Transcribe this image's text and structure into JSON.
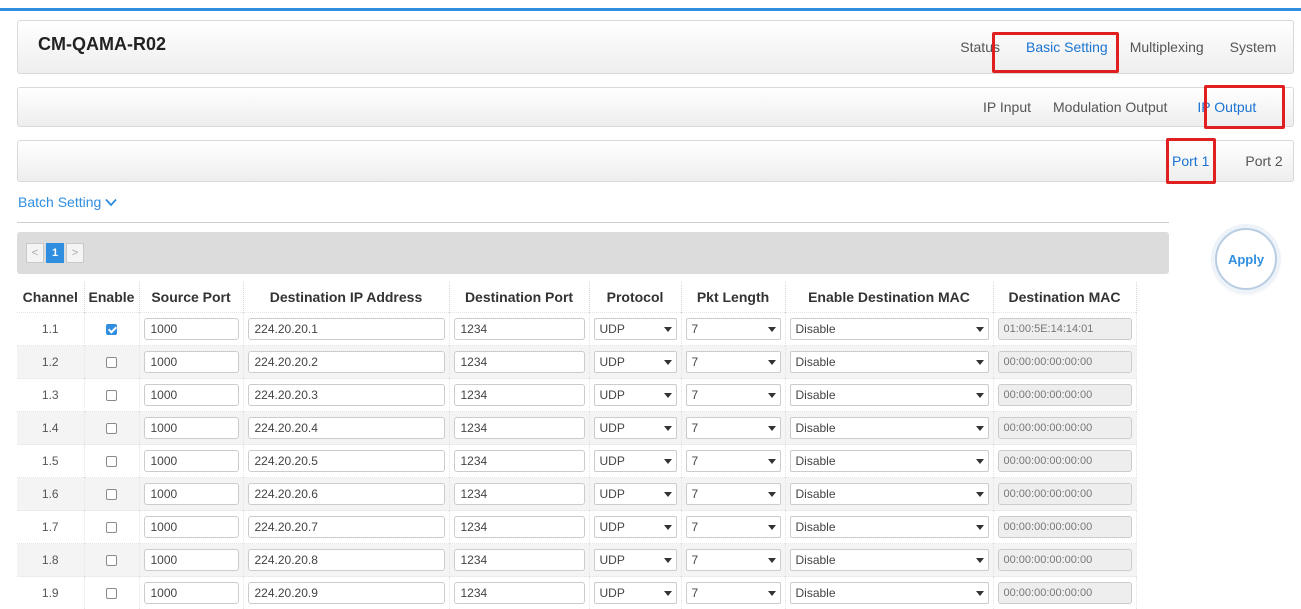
{
  "app": {
    "title": "CM-QAMA-R02"
  },
  "main_nav": [
    "Status",
    "Basic Setting",
    "Multiplexing",
    "System"
  ],
  "sub_nav": [
    "IP Input",
    "Modulation Output",
    "IP Output"
  ],
  "port_tabs": [
    "Port 1",
    "Port 2"
  ],
  "batch_setting": {
    "label": "Batch Setting"
  },
  "pager": {
    "prev": "<",
    "current": "1",
    "next": ">"
  },
  "apply_label": "Apply",
  "table": {
    "headers": [
      "Channel",
      "Enable",
      "Source Port",
      "Destination IP Address",
      "Destination Port",
      "Protocol",
      "Pkt Length",
      "Enable Destination MAC",
      "Destination MAC"
    ],
    "rows": [
      {
        "channel": "1.1",
        "enabled": true,
        "source_port": "1000",
        "dest_ip": "224.20.20.1",
        "dest_port": "1234",
        "protocol": "UDP",
        "pkt_length": "7",
        "enable_dest_mac": "Disable",
        "dest_mac": "01:00:5E:14:14:01"
      },
      {
        "channel": "1.2",
        "enabled": false,
        "source_port": "1000",
        "dest_ip": "224.20.20.2",
        "dest_port": "1234",
        "protocol": "UDP",
        "pkt_length": "7",
        "enable_dest_mac": "Disable",
        "dest_mac": "00:00:00:00:00:00"
      },
      {
        "channel": "1.3",
        "enabled": false,
        "source_port": "1000",
        "dest_ip": "224.20.20.3",
        "dest_port": "1234",
        "protocol": "UDP",
        "pkt_length": "7",
        "enable_dest_mac": "Disable",
        "dest_mac": "00:00:00:00:00:00"
      },
      {
        "channel": "1.4",
        "enabled": false,
        "source_port": "1000",
        "dest_ip": "224.20.20.4",
        "dest_port": "1234",
        "protocol": "UDP",
        "pkt_length": "7",
        "enable_dest_mac": "Disable",
        "dest_mac": "00:00:00:00:00:00"
      },
      {
        "channel": "1.5",
        "enabled": false,
        "source_port": "1000",
        "dest_ip": "224.20.20.5",
        "dest_port": "1234",
        "protocol": "UDP",
        "pkt_length": "7",
        "enable_dest_mac": "Disable",
        "dest_mac": "00:00:00:00:00:00"
      },
      {
        "channel": "1.6",
        "enabled": false,
        "source_port": "1000",
        "dest_ip": "224.20.20.6",
        "dest_port": "1234",
        "protocol": "UDP",
        "pkt_length": "7",
        "enable_dest_mac": "Disable",
        "dest_mac": "00:00:00:00:00:00"
      },
      {
        "channel": "1.7",
        "enabled": false,
        "source_port": "1000",
        "dest_ip": "224.20.20.7",
        "dest_port": "1234",
        "protocol": "UDP",
        "pkt_length": "7",
        "enable_dest_mac": "Disable",
        "dest_mac": "00:00:00:00:00:00"
      },
      {
        "channel": "1.8",
        "enabled": false,
        "source_port": "1000",
        "dest_ip": "224.20.20.8",
        "dest_port": "1234",
        "protocol": "UDP",
        "pkt_length": "7",
        "enable_dest_mac": "Disable",
        "dest_mac": "00:00:00:00:00:00"
      },
      {
        "channel": "1.9",
        "enabled": false,
        "source_port": "1000",
        "dest_ip": "224.20.20.9",
        "dest_port": "1234",
        "protocol": "UDP",
        "pkt_length": "7",
        "enable_dest_mac": "Disable",
        "dest_mac": "00:00:00:00:00:00"
      }
    ]
  },
  "colors": {
    "accent": "#2f8ee0",
    "highlight": "#e02020",
    "header_bg": "#eeeeee"
  }
}
